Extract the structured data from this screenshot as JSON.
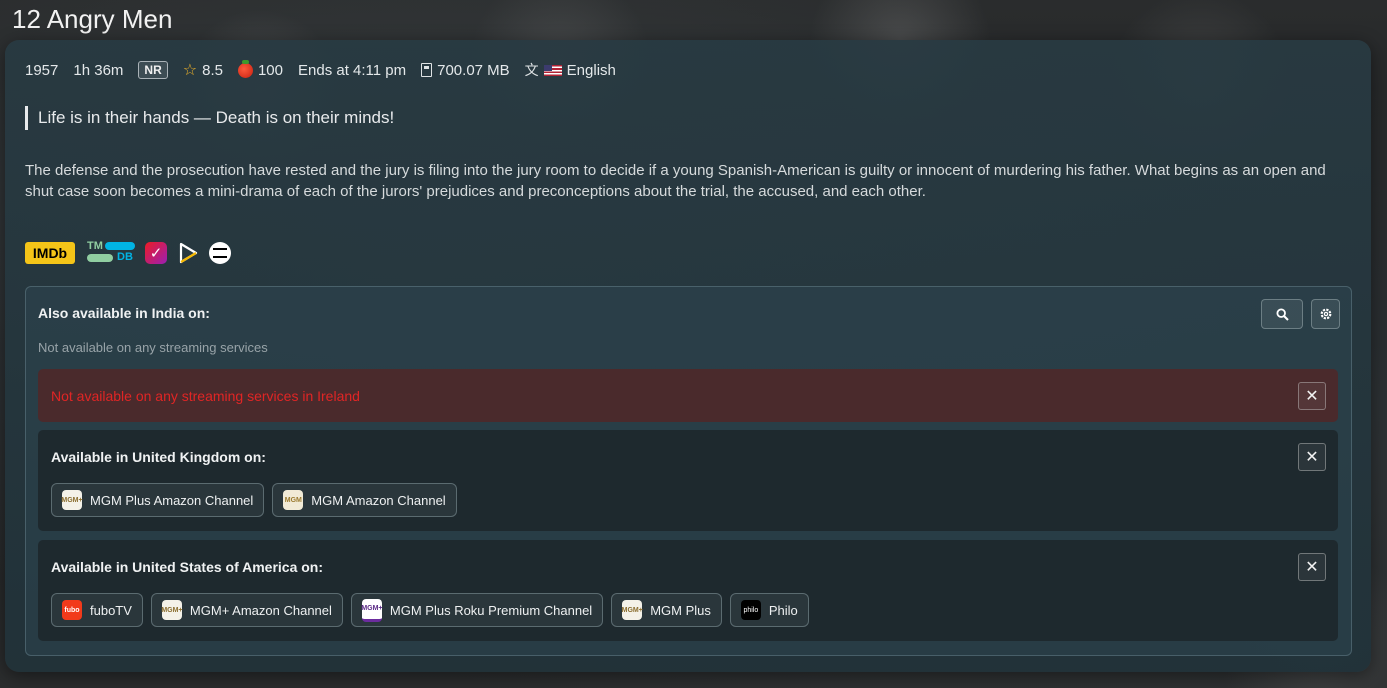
{
  "title": "12 Angry Men",
  "meta": {
    "year": "1957",
    "runtime": "1h 36m",
    "rating_badge": "NR",
    "star_rating": "8.5",
    "tomato_score": "100",
    "ends_at": "Ends at 4:11 pm",
    "file_size": "700.07 MB",
    "language": "English"
  },
  "tagline": "Life is in their hands — Death is on their minds!",
  "overview": "The defense and the prosecution have rested and the jury is filing into the jury room to decide if a young Spanish-American is guilty or innocent of murdering his father. What begins as an open and shut case soon becomes a mini-drama of each of the jurors' prejudices and preconceptions about the trial, the accused, and each other.",
  "external_links": {
    "imdb": "IMDb",
    "tmdb_top": "TM",
    "tmdb_bottom": "DB"
  },
  "availability": {
    "home_title": "Also available in India on:",
    "home_subtitle": "Not available on any streaming services",
    "alert_text": "Not available on any streaming services in Ireland",
    "regions": [
      {
        "title": "Available in United Kingdom on:",
        "providers": [
          {
            "name": "MGM Plus Amazon Channel",
            "logo_text": "MGM+"
          },
          {
            "name": "MGM Amazon Channel",
            "logo_text": "MGM"
          }
        ]
      },
      {
        "title": "Available in United States of America on:",
        "providers": [
          {
            "name": "fuboTV",
            "logo_text": "fubo"
          },
          {
            "name": "MGM+ Amazon Channel",
            "logo_text": "MGM+"
          },
          {
            "name": "MGM Plus Roku Premium Channel",
            "logo_text": "MGM+"
          },
          {
            "name": "MGM Plus",
            "logo_text": "MGM+"
          },
          {
            "name": "Philo",
            "logo_text": "philo"
          }
        ]
      }
    ]
  },
  "icons": {
    "star": "star-icon",
    "tomato": "tomato-icon",
    "file": "file-size-icon",
    "translate": "translate-icon",
    "flag": "us-flag-icon",
    "search": "search-icon",
    "gear": "gear-icon",
    "close": "close-icon"
  },
  "colors": {
    "accent_star": "#f0b429",
    "imdb_yellow": "#f5c518",
    "alert_text": "#e02525",
    "alert_bg": "#4a2a2c"
  }
}
